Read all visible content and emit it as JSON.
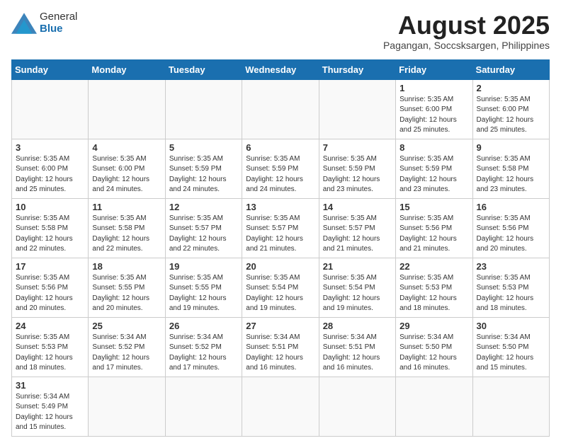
{
  "header": {
    "logo_line1": "General",
    "logo_line2": "Blue",
    "month_title": "August 2025",
    "subtitle": "Pagangan, Soccsksargen, Philippines"
  },
  "weekdays": [
    "Sunday",
    "Monday",
    "Tuesday",
    "Wednesday",
    "Thursday",
    "Friday",
    "Saturday"
  ],
  "weeks": [
    [
      {
        "day": "",
        "info": ""
      },
      {
        "day": "",
        "info": ""
      },
      {
        "day": "",
        "info": ""
      },
      {
        "day": "",
        "info": ""
      },
      {
        "day": "",
        "info": ""
      },
      {
        "day": "1",
        "info": "Sunrise: 5:35 AM\nSunset: 6:00 PM\nDaylight: 12 hours\nand 25 minutes."
      },
      {
        "day": "2",
        "info": "Sunrise: 5:35 AM\nSunset: 6:00 PM\nDaylight: 12 hours\nand 25 minutes."
      }
    ],
    [
      {
        "day": "3",
        "info": "Sunrise: 5:35 AM\nSunset: 6:00 PM\nDaylight: 12 hours\nand 25 minutes."
      },
      {
        "day": "4",
        "info": "Sunrise: 5:35 AM\nSunset: 6:00 PM\nDaylight: 12 hours\nand 24 minutes."
      },
      {
        "day": "5",
        "info": "Sunrise: 5:35 AM\nSunset: 5:59 PM\nDaylight: 12 hours\nand 24 minutes."
      },
      {
        "day": "6",
        "info": "Sunrise: 5:35 AM\nSunset: 5:59 PM\nDaylight: 12 hours\nand 24 minutes."
      },
      {
        "day": "7",
        "info": "Sunrise: 5:35 AM\nSunset: 5:59 PM\nDaylight: 12 hours\nand 23 minutes."
      },
      {
        "day": "8",
        "info": "Sunrise: 5:35 AM\nSunset: 5:59 PM\nDaylight: 12 hours\nand 23 minutes."
      },
      {
        "day": "9",
        "info": "Sunrise: 5:35 AM\nSunset: 5:58 PM\nDaylight: 12 hours\nand 23 minutes."
      }
    ],
    [
      {
        "day": "10",
        "info": "Sunrise: 5:35 AM\nSunset: 5:58 PM\nDaylight: 12 hours\nand 22 minutes."
      },
      {
        "day": "11",
        "info": "Sunrise: 5:35 AM\nSunset: 5:58 PM\nDaylight: 12 hours\nand 22 minutes."
      },
      {
        "day": "12",
        "info": "Sunrise: 5:35 AM\nSunset: 5:57 PM\nDaylight: 12 hours\nand 22 minutes."
      },
      {
        "day": "13",
        "info": "Sunrise: 5:35 AM\nSunset: 5:57 PM\nDaylight: 12 hours\nand 21 minutes."
      },
      {
        "day": "14",
        "info": "Sunrise: 5:35 AM\nSunset: 5:57 PM\nDaylight: 12 hours\nand 21 minutes."
      },
      {
        "day": "15",
        "info": "Sunrise: 5:35 AM\nSunset: 5:56 PM\nDaylight: 12 hours\nand 21 minutes."
      },
      {
        "day": "16",
        "info": "Sunrise: 5:35 AM\nSunset: 5:56 PM\nDaylight: 12 hours\nand 20 minutes."
      }
    ],
    [
      {
        "day": "17",
        "info": "Sunrise: 5:35 AM\nSunset: 5:56 PM\nDaylight: 12 hours\nand 20 minutes."
      },
      {
        "day": "18",
        "info": "Sunrise: 5:35 AM\nSunset: 5:55 PM\nDaylight: 12 hours\nand 20 minutes."
      },
      {
        "day": "19",
        "info": "Sunrise: 5:35 AM\nSunset: 5:55 PM\nDaylight: 12 hours\nand 19 minutes."
      },
      {
        "day": "20",
        "info": "Sunrise: 5:35 AM\nSunset: 5:54 PM\nDaylight: 12 hours\nand 19 minutes."
      },
      {
        "day": "21",
        "info": "Sunrise: 5:35 AM\nSunset: 5:54 PM\nDaylight: 12 hours\nand 19 minutes."
      },
      {
        "day": "22",
        "info": "Sunrise: 5:35 AM\nSunset: 5:53 PM\nDaylight: 12 hours\nand 18 minutes."
      },
      {
        "day": "23",
        "info": "Sunrise: 5:35 AM\nSunset: 5:53 PM\nDaylight: 12 hours\nand 18 minutes."
      }
    ],
    [
      {
        "day": "24",
        "info": "Sunrise: 5:35 AM\nSunset: 5:53 PM\nDaylight: 12 hours\nand 18 minutes."
      },
      {
        "day": "25",
        "info": "Sunrise: 5:34 AM\nSunset: 5:52 PM\nDaylight: 12 hours\nand 17 minutes."
      },
      {
        "day": "26",
        "info": "Sunrise: 5:34 AM\nSunset: 5:52 PM\nDaylight: 12 hours\nand 17 minutes."
      },
      {
        "day": "27",
        "info": "Sunrise: 5:34 AM\nSunset: 5:51 PM\nDaylight: 12 hours\nand 16 minutes."
      },
      {
        "day": "28",
        "info": "Sunrise: 5:34 AM\nSunset: 5:51 PM\nDaylight: 12 hours\nand 16 minutes."
      },
      {
        "day": "29",
        "info": "Sunrise: 5:34 AM\nSunset: 5:50 PM\nDaylight: 12 hours\nand 16 minutes."
      },
      {
        "day": "30",
        "info": "Sunrise: 5:34 AM\nSunset: 5:50 PM\nDaylight: 12 hours\nand 15 minutes."
      }
    ],
    [
      {
        "day": "31",
        "info": "Sunrise: 5:34 AM\nSunset: 5:49 PM\nDaylight: 12 hours\nand 15 minutes."
      },
      {
        "day": "",
        "info": ""
      },
      {
        "day": "",
        "info": ""
      },
      {
        "day": "",
        "info": ""
      },
      {
        "day": "",
        "info": ""
      },
      {
        "day": "",
        "info": ""
      },
      {
        "day": "",
        "info": ""
      }
    ]
  ]
}
